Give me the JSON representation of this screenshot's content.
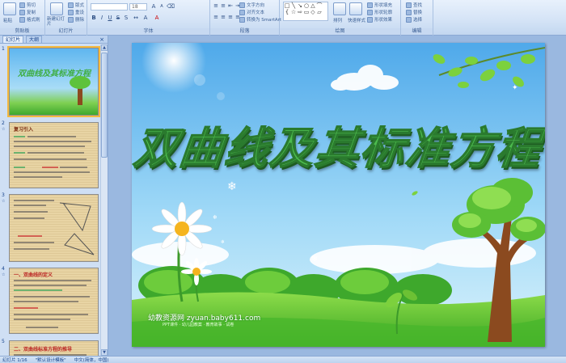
{
  "ribbon": {
    "clipboard": {
      "group_label": "剪贴板",
      "paste": "粘贴",
      "cut": "剪切",
      "copy": "复制",
      "format_painter": "格式刷"
    },
    "slides": {
      "group_label": "幻灯片",
      "new_slide": "新建幻灯片",
      "layout": "版式",
      "reset": "重设",
      "delete": "删除"
    },
    "font": {
      "group_label": "字体",
      "font_size": "18"
    },
    "paragraph": {
      "group_label": "段落",
      "text_direction": "文字方向",
      "align_text": "对齐文本",
      "smartart": "转换为 SmartArt"
    },
    "drawing": {
      "group_label": "绘图",
      "arrange": "排列",
      "quick_styles": "快速样式",
      "shape_fill": "形状填充",
      "shape_outline": "形状轮廓",
      "shape_effects": "形状效果"
    },
    "editing": {
      "group_label": "编辑",
      "find": "查找",
      "replace": "替换",
      "select": "选择"
    }
  },
  "pane": {
    "tab_slides": "幻灯片",
    "tab_outline": "大纲",
    "close": "×",
    "thumbs": [
      {
        "num": "1",
        "title": "双曲线及其标准方程"
      },
      {
        "num": "2",
        "title": "复习引入"
      },
      {
        "num": "3",
        "title": ""
      },
      {
        "num": "4",
        "title": "一、双曲线的定义"
      },
      {
        "num": "5",
        "title": "二、双曲线标准方程的推导"
      }
    ]
  },
  "slide": {
    "title": "双曲线及其标准方程",
    "site_name": "幼教资源网 zyuan.baby611.com",
    "site_tagline": "PPT课件 · 幼儿园教案 · 教育故事 · 试卷"
  },
  "status": {
    "slide_count": "幻灯片 1/16",
    "theme": "\"默认设计模板\"",
    "language": "中文(简体，中国)"
  },
  "colors": {
    "ribbon_bg": "#d4e3f6",
    "title_green": "#4cbb4e",
    "sky": "#7cc8f0",
    "grass": "#5cc63a"
  }
}
